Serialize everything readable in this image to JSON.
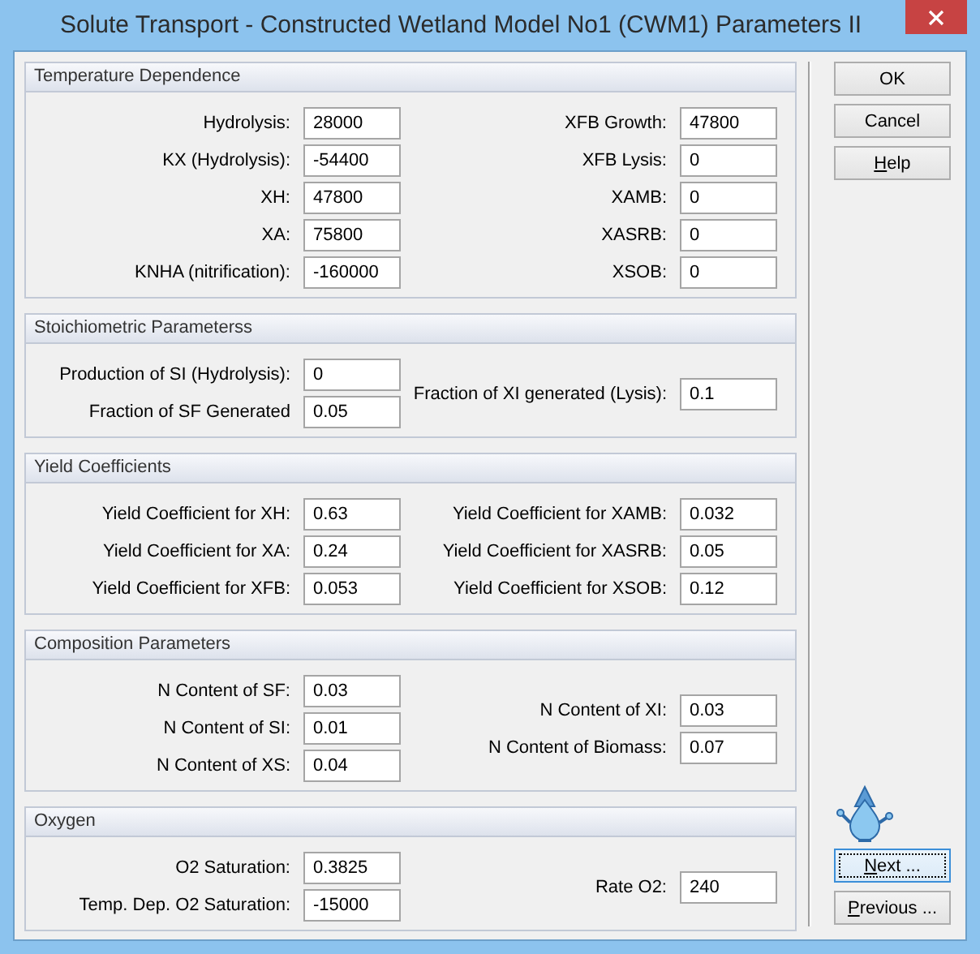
{
  "window": {
    "title": "Solute Transport - Constructed Wetland Model No1 (CWM1) Parameters II"
  },
  "groups": [
    {
      "title": "Temperature Dependence",
      "left": [
        {
          "label": "Hydrolysis:",
          "value": "28000"
        },
        {
          "label": "KX (Hydrolysis):",
          "value": "-54400"
        },
        {
          "label": "XH:",
          "value": "47800"
        },
        {
          "label": "XA:",
          "value": "75800"
        },
        {
          "label": "KNHA (nitrification):",
          "value": "-160000"
        }
      ],
      "right": [
        {
          "label": "XFB Growth:",
          "value": "47800"
        },
        {
          "label": "XFB Lysis:",
          "value": "0"
        },
        {
          "label": "XAMB:",
          "value": "0"
        },
        {
          "label": "XASRB:",
          "value": "0"
        },
        {
          "label": "XSOB:",
          "value": "0"
        }
      ]
    },
    {
      "title": "Stoichiometric Parameterss",
      "left": [
        {
          "label": "Production of SI (Hydrolysis):",
          "value": "0"
        },
        {
          "label": "Fraction of SF Generated",
          "value": "0.05"
        }
      ],
      "right": [
        {
          "label": "Fraction of XI generated (Lysis):",
          "value": "0.1"
        }
      ]
    },
    {
      "title": "Yield Coefficients",
      "left": [
        {
          "label": "Yield Coefficient for XH:",
          "value": "0.63"
        },
        {
          "label": "Yield Coefficient for XA:",
          "value": "0.24"
        },
        {
          "label": "Yield Coefficient for XFB:",
          "value": "0.053"
        }
      ],
      "right": [
        {
          "label": "Yield Coefficient for XAMB:",
          "value": "0.032"
        },
        {
          "label": "Yield Coefficient for XASRB:",
          "value": "0.05"
        },
        {
          "label": "Yield Coefficient for XSOB:",
          "value": "0.12"
        }
      ]
    },
    {
      "title": "Composition Parameters",
      "left": [
        {
          "label": "N Content of SF:",
          "value": "0.03"
        },
        {
          "label": "N Content of SI:",
          "value": "0.01"
        },
        {
          "label": "N Content of XS:",
          "value": "0.04"
        }
      ],
      "right": [
        {
          "label": "N Content of XI:",
          "value": "0.03"
        },
        {
          "label": "N Content of Biomass:",
          "value": "0.07"
        }
      ]
    },
    {
      "title": "Oxygen",
      "left": [
        {
          "label": "O2 Saturation:",
          "value": "0.3825"
        },
        {
          "label": "Temp. Dep. O2 Saturation:",
          "value": "-15000"
        }
      ],
      "right": [
        {
          "label": "Rate O2:",
          "value": "240"
        }
      ]
    }
  ],
  "buttons_top": [
    {
      "label": "OK",
      "underline_first": false,
      "focused": false
    },
    {
      "label": "Cancel",
      "underline_first": false,
      "focused": false
    },
    {
      "label": "Help",
      "underline_first": true,
      "focused": false
    }
  ],
  "buttons_bottom": [
    {
      "label": "Next ...",
      "underline_first": true,
      "focused": true
    },
    {
      "label": "Previous ...",
      "underline_first": true,
      "focused": false
    }
  ]
}
